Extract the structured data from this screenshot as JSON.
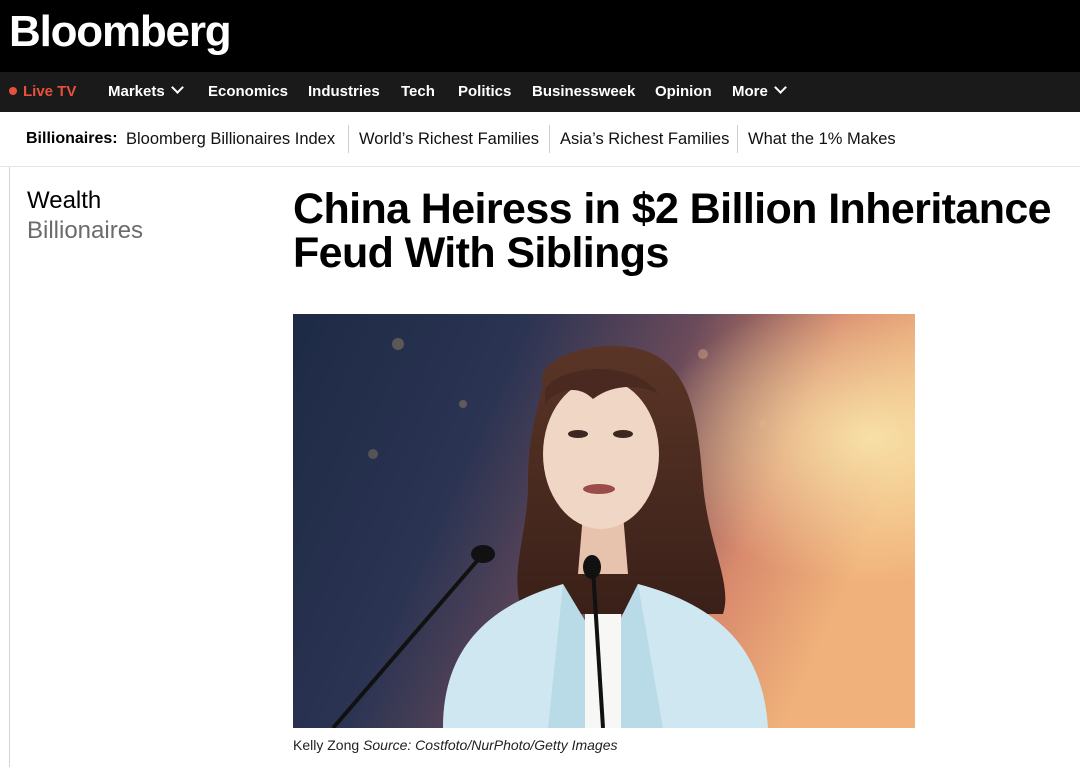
{
  "brand": {
    "name": "Bloomberg"
  },
  "nav": {
    "live": "Live TV",
    "items": [
      "Markets",
      "Economics",
      "Industries",
      "Tech",
      "Politics",
      "Businessweek",
      "Opinion",
      "More"
    ]
  },
  "subnav": {
    "label": "Billionaires:",
    "links": [
      "Bloomberg Billionaires Index",
      "World’s Richest Families",
      "Asia’s Richest Families",
      "What the 1% Makes"
    ]
  },
  "article": {
    "section": "Wealth",
    "subsection": "Billionaires",
    "headline": "China Heiress in $2 Billion Inheritance Feud With Siblings",
    "caption_name": "Kelly Zong",
    "caption_source": "Source: Costfoto/NurPhoto/Getty Images"
  },
  "colors": {
    "topbar": "#000000",
    "navbar": "#1a1a1a",
    "live_accent": "#e8503e"
  },
  "icons": [
    "chevron-down-icon",
    "live-dot-icon"
  ]
}
